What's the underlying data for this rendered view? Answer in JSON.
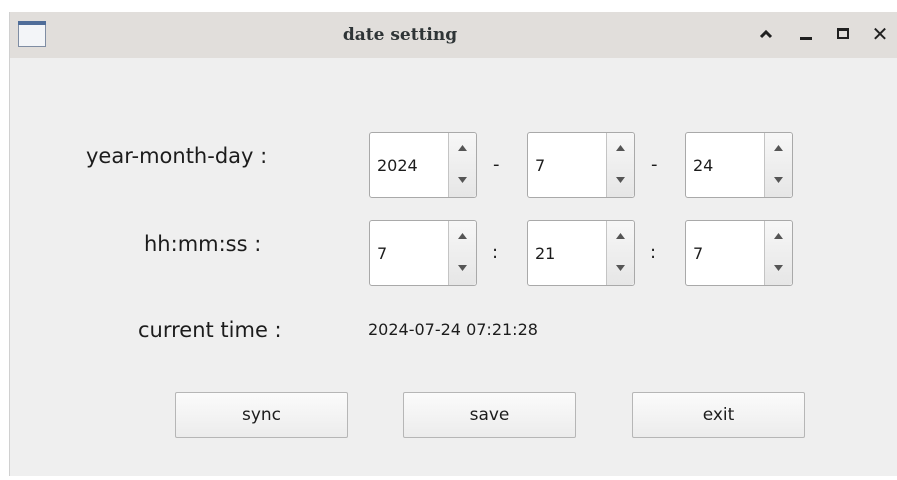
{
  "window": {
    "title": "date setting"
  },
  "titlebar": {
    "buttons": [
      {
        "name": "keep-above",
        "icon": "chevron-up-icon"
      },
      {
        "name": "minimize",
        "icon": "minimize-icon"
      },
      {
        "name": "maximize",
        "icon": "maximize-icon"
      },
      {
        "name": "close",
        "icon": "close-icon",
        "label": "✕"
      }
    ]
  },
  "form": {
    "date_label": "year-month-day :",
    "time_label": "hh:mm:ss :",
    "current_label": "current time :",
    "date_sep": "-",
    "time_sep": ":",
    "year": "2024",
    "month": "7",
    "day": "24",
    "hour": "7",
    "minute": "21",
    "second": "7",
    "current_time": "2024-07-24 07:21:28"
  },
  "buttons": {
    "sync": "sync",
    "save": "save",
    "exit": "exit"
  },
  "colors": {
    "titlebar_bg": "#e1dedb",
    "window_bg": "#efefef",
    "app_icon_accent": "#4f6d99"
  }
}
